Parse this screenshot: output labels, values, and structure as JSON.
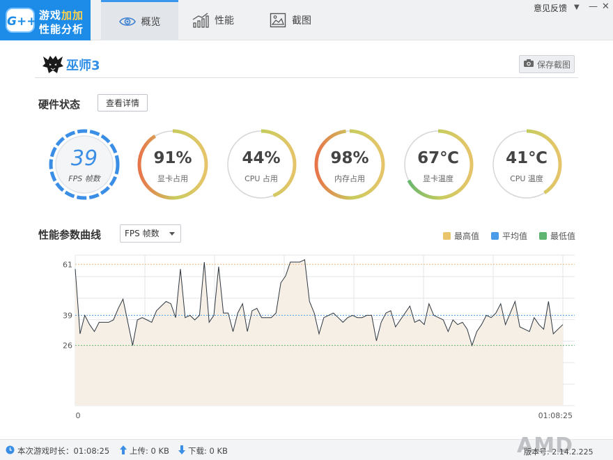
{
  "app": {
    "logo_line1_a": "游戏",
    "logo_line1_b": "加加",
    "logo_line2": "性能分析",
    "logo_badge": "G++"
  },
  "tabs": [
    {
      "label": "概览",
      "active": true,
      "icon": "eye-icon"
    },
    {
      "label": "性能",
      "active": false,
      "icon": "bar-chart-icon"
    },
    {
      "label": "截图",
      "active": false,
      "icon": "image-icon"
    }
  ],
  "window": {
    "feedback": "意见反馈",
    "dropdown": "▼",
    "minimize": "—",
    "close": "✕"
  },
  "game": {
    "title": "巫师3",
    "save_label": "保存截图",
    "icon": "wolf-medallion-icon"
  },
  "hardware": {
    "title": "硬件状态",
    "detail_label": "查看详情",
    "gauges": [
      {
        "value": "39",
        "label": "FPS 帧数",
        "percent": 100
      },
      {
        "value": "91%",
        "label": "显卡占用",
        "percent": 91
      },
      {
        "value": "44%",
        "label": "CPU 占用",
        "percent": 44
      },
      {
        "value": "98%",
        "label": "内存占用",
        "percent": 98
      },
      {
        "value": "67℃",
        "label": "显卡温度",
        "percent": 67
      },
      {
        "value": "41℃",
        "label": "CPU 温度",
        "percent": 41
      }
    ]
  },
  "curve": {
    "title": "性能参数曲线",
    "select_value": "FPS 帧数",
    "legend": [
      {
        "label": "最高值",
        "color": "#e9c46a"
      },
      {
        "label": "平均值",
        "color": "#4a9be8"
      },
      {
        "label": "最低值",
        "color": "#5fb571"
      }
    ]
  },
  "chart_data": {
    "type": "area",
    "yticks": [
      61,
      39,
      26
    ],
    "max": 61,
    "avg": 39,
    "min": 26,
    "ylim": [
      0,
      65
    ],
    "x_start_label": "0",
    "x_end_label": "01:08:25",
    "values": [
      59,
      31,
      39,
      35,
      32,
      36,
      36,
      36,
      37,
      42,
      46,
      36,
      26,
      37,
      38,
      37,
      36,
      41,
      43,
      45,
      44,
      38,
      59,
      38,
      39,
      37,
      39,
      62,
      36,
      39,
      60,
      40,
      40,
      32,
      40,
      44,
      32,
      41,
      42,
      38,
      38,
      38,
      40,
      53,
      56,
      62,
      62,
      62,
      63,
      45,
      40,
      31,
      38,
      39,
      40,
      38,
      36,
      38,
      39,
      38,
      38,
      39,
      39,
      28,
      36,
      40,
      41,
      34,
      37,
      40,
      43,
      36,
      37,
      35,
      44,
      39,
      38,
      37,
      32,
      37,
      35,
      36,
      33,
      26,
      32,
      35,
      39,
      38,
      40,
      44,
      35,
      40,
      45,
      34,
      33,
      32,
      38,
      35,
      33,
      45,
      31,
      33,
      35
    ]
  },
  "status": {
    "duration_label": "本次游戏时长：01:08:25",
    "upload_label": "上传: 0 KB",
    "download_label": "下载: 0 KB",
    "version_label": "版本号: 2.14.2.225",
    "brand": "AMD"
  }
}
